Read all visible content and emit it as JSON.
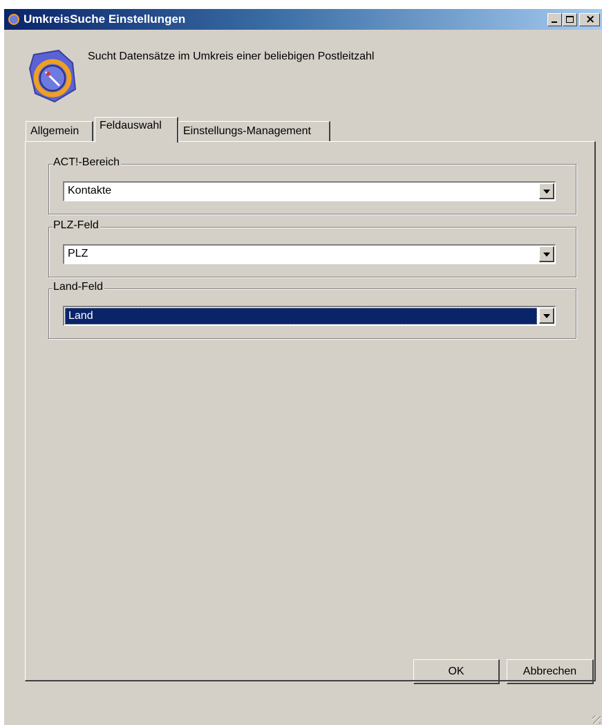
{
  "window": {
    "title": "UmkreisSuche Einstellungen",
    "description": "Sucht Datensätze im Umkreis einer beliebigen Postleitzahl",
    "title_gradient_start": "#0a246a",
    "title_gradient_end": "#a6caf0"
  },
  "tabs": [
    {
      "label": "Allgemein",
      "active": false
    },
    {
      "label": "Feldauswahl",
      "active": true
    },
    {
      "label": "Einstellungs-Management",
      "active": false
    }
  ],
  "groups": [
    {
      "legend": "ACT!-Bereich",
      "value": "Kontakte",
      "focused": false
    },
    {
      "legend": "PLZ-Feld",
      "value": "PLZ",
      "focused": false
    },
    {
      "legend": "Land-Feld",
      "value": "Land",
      "focused": true
    }
  ],
  "buttons": {
    "ok_label": "OK",
    "cancel_label": "Abbrechen"
  },
  "icons": {
    "app": "radar-search-icon",
    "minimize": "minimize-icon",
    "maximize": "maximize-icon",
    "close": "close-icon",
    "dropdown": "chevron-down-icon"
  },
  "colors": {
    "face": "#d4d0c8",
    "selection": "#0a246a"
  }
}
